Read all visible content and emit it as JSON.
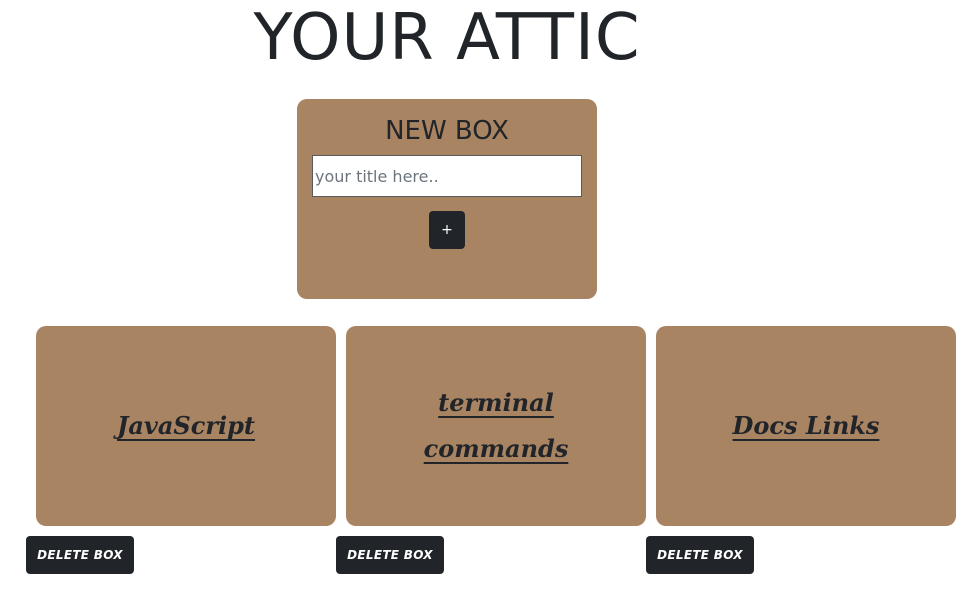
{
  "page": {
    "title": "YOUR ATTIC"
  },
  "new_box": {
    "title": "NEW BOX",
    "input_placeholder": "your title here..",
    "input_value": "",
    "add_label": "+"
  },
  "boxes": [
    {
      "title": "JavaScript",
      "delete_label": "DELETE BOX"
    },
    {
      "title": "terminal commands",
      "delete_label": "DELETE BOX"
    },
    {
      "title": "Docs Links",
      "delete_label": "DELETE BOX"
    }
  ],
  "colors": {
    "card_background": "#a98462",
    "button_background": "#212529",
    "text": "#212529"
  }
}
